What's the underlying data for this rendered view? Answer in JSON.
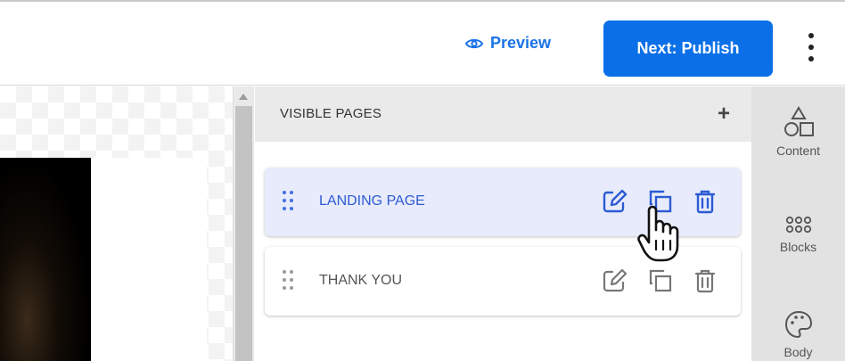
{
  "toolbar": {
    "preview_label": "Preview",
    "publish_label": "Next: Publish",
    "accent_color": "#0b6fe8"
  },
  "pages": {
    "header": "VISIBLE PAGES",
    "add_icon": "plus-icon",
    "items": [
      {
        "label": "LANDING PAGE",
        "selected": true
      },
      {
        "label": "THANK YOU",
        "selected": false
      }
    ]
  },
  "rail": {
    "items": [
      {
        "label": "Content",
        "icon": "shapes-icon"
      },
      {
        "label": "Blocks",
        "icon": "grid-dots-icon"
      },
      {
        "label": "Body",
        "icon": "palette-icon"
      }
    ]
  }
}
